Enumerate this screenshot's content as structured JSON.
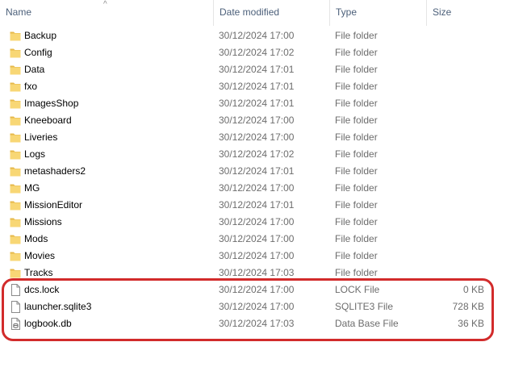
{
  "columns": {
    "name": "Name",
    "date": "Date modified",
    "type": "Type",
    "size": "Size"
  },
  "sort_indicator": "^",
  "rows": [
    {
      "name": "Backup",
      "date": "30/12/2024 17:00",
      "type": "File folder",
      "size": "",
      "icon": "folder-icon"
    },
    {
      "name": "Config",
      "date": "30/12/2024 17:02",
      "type": "File folder",
      "size": "",
      "icon": "folder-icon"
    },
    {
      "name": "Data",
      "date": "30/12/2024 17:01",
      "type": "File folder",
      "size": "",
      "icon": "folder-icon"
    },
    {
      "name": "fxo",
      "date": "30/12/2024 17:01",
      "type": "File folder",
      "size": "",
      "icon": "folder-icon"
    },
    {
      "name": "ImagesShop",
      "date": "30/12/2024 17:01",
      "type": "File folder",
      "size": "",
      "icon": "folder-icon"
    },
    {
      "name": "Kneeboard",
      "date": "30/12/2024 17:00",
      "type": "File folder",
      "size": "",
      "icon": "folder-icon"
    },
    {
      "name": "Liveries",
      "date": "30/12/2024 17:00",
      "type": "File folder",
      "size": "",
      "icon": "folder-icon"
    },
    {
      "name": "Logs",
      "date": "30/12/2024 17:02",
      "type": "File folder",
      "size": "",
      "icon": "folder-icon"
    },
    {
      "name": "metashaders2",
      "date": "30/12/2024 17:01",
      "type": "File folder",
      "size": "",
      "icon": "folder-icon"
    },
    {
      "name": "MG",
      "date": "30/12/2024 17:00",
      "type": "File folder",
      "size": "",
      "icon": "folder-icon"
    },
    {
      "name": "MissionEditor",
      "date": "30/12/2024 17:01",
      "type": "File folder",
      "size": "",
      "icon": "folder-icon"
    },
    {
      "name": "Missions",
      "date": "30/12/2024 17:00",
      "type": "File folder",
      "size": "",
      "icon": "folder-icon"
    },
    {
      "name": "Mods",
      "date": "30/12/2024 17:00",
      "type": "File folder",
      "size": "",
      "icon": "folder-icon"
    },
    {
      "name": "Movies",
      "date": "30/12/2024 17:00",
      "type": "File folder",
      "size": "",
      "icon": "folder-icon"
    },
    {
      "name": "Tracks",
      "date": "30/12/2024 17:03",
      "type": "File folder",
      "size": "",
      "icon": "folder-icon"
    },
    {
      "name": "dcs.lock",
      "date": "30/12/2024 17:00",
      "type": "LOCK File",
      "size": "0 KB",
      "icon": "file-icon"
    },
    {
      "name": "launcher.sqlite3",
      "date": "30/12/2024 17:00",
      "type": "SQLITE3 File",
      "size": "728 KB",
      "icon": "file-icon"
    },
    {
      "name": "logbook.db",
      "date": "30/12/2024 17:03",
      "type": "Data Base File",
      "size": "36 KB",
      "icon": "database-file-icon"
    }
  ],
  "colors": {
    "folder": "#f8d775",
    "folder_dark": "#e6b84a",
    "highlight": "#d22b2b",
    "header_text": "#4c607a",
    "meta_text": "#6d6d6d"
  }
}
